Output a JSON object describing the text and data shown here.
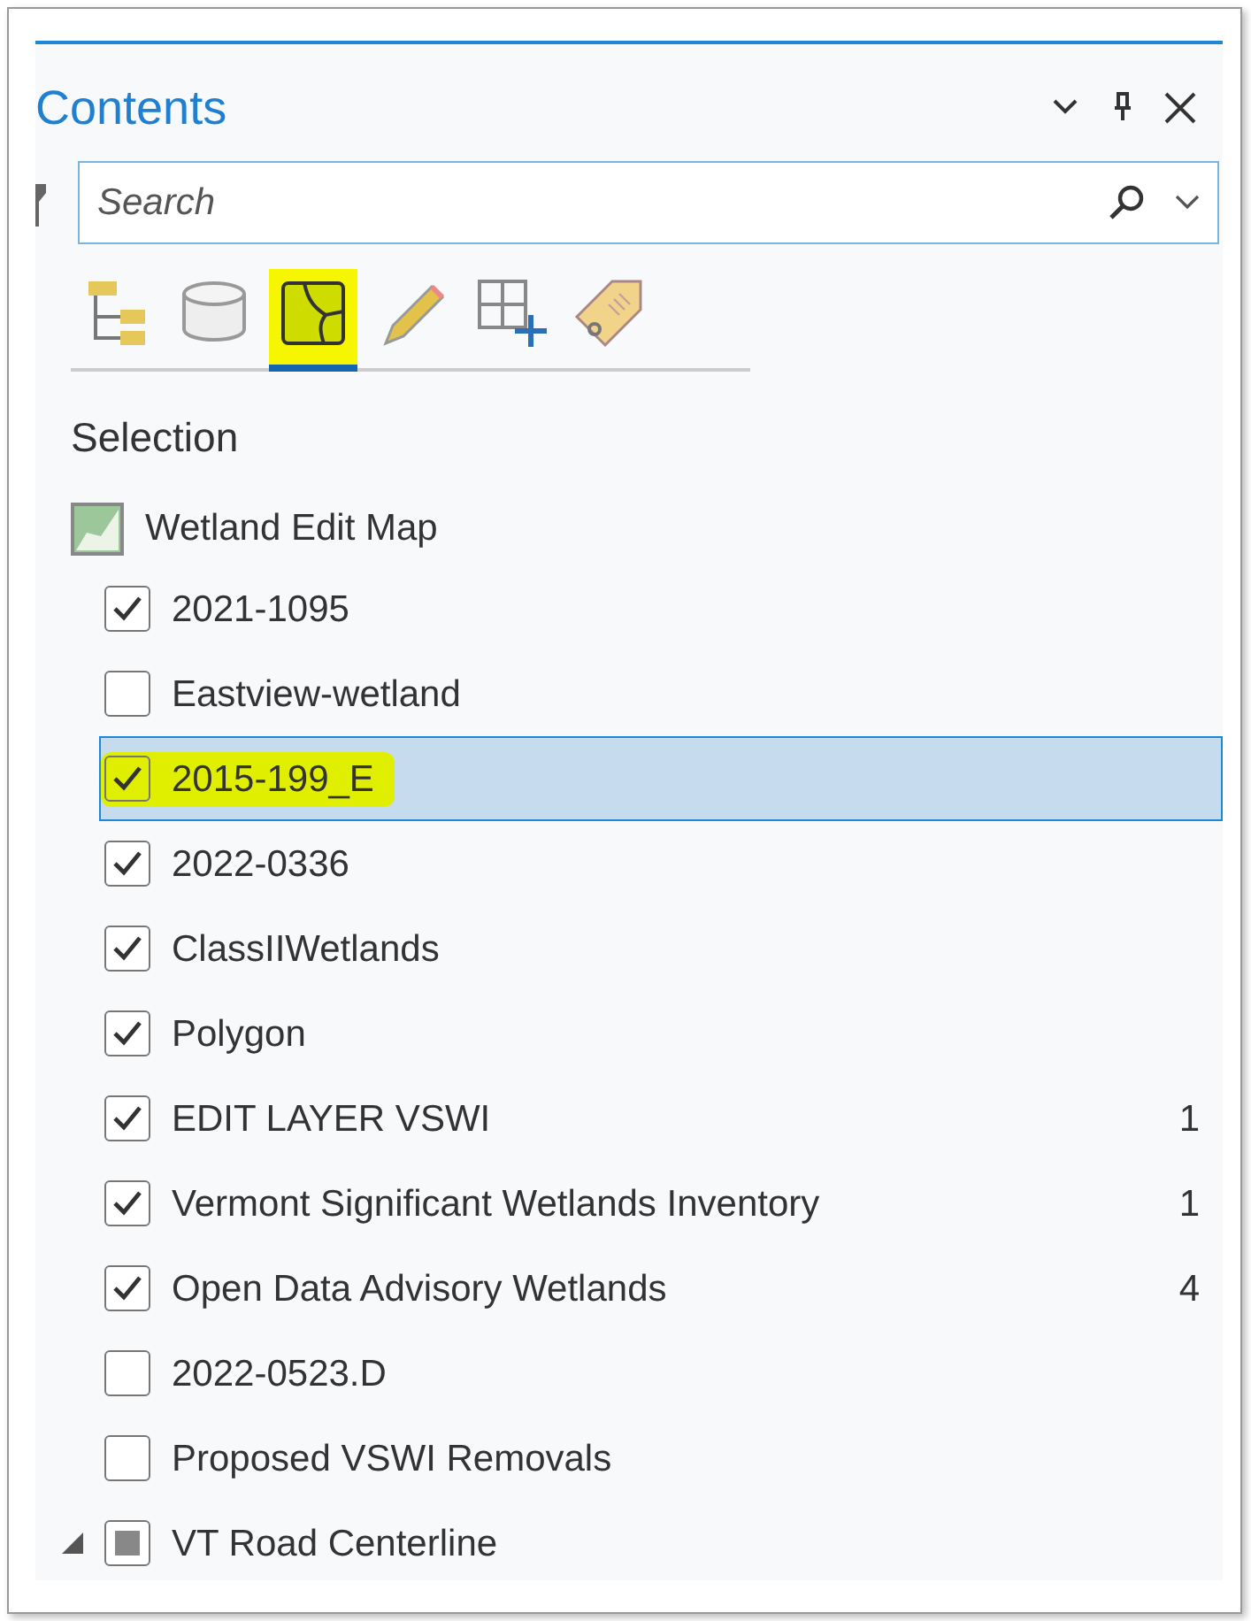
{
  "pane": {
    "title": "Contents"
  },
  "search": {
    "placeholder": "Search"
  },
  "tabs": [
    {
      "kind": "tree",
      "selected": false,
      "highlighted": false
    },
    {
      "kind": "database",
      "selected": false,
      "highlighted": false
    },
    {
      "kind": "polygon",
      "selected": true,
      "highlighted": true
    },
    {
      "kind": "pencil",
      "selected": false,
      "highlighted": false
    },
    {
      "kind": "grid",
      "selected": false,
      "highlighted": false
    },
    {
      "kind": "tag",
      "selected": false,
      "highlighted": false
    }
  ],
  "section_title": "Selection",
  "map": {
    "name": "Wetland Edit Map"
  },
  "layers": [
    {
      "kind": "layer",
      "name": "2021-1095",
      "checked": true,
      "selected": false,
      "highlighted": false
    },
    {
      "kind": "layer",
      "name": "Eastview-wetland",
      "checked": false,
      "selected": false,
      "highlighted": false
    },
    {
      "kind": "layer",
      "name": "2015-199_E",
      "checked": true,
      "selected": true,
      "highlighted": true
    },
    {
      "kind": "layer",
      "name": "2022-0336",
      "checked": true,
      "selected": false,
      "highlighted": false
    },
    {
      "kind": "layer",
      "name": "ClassIIWetlands",
      "checked": true,
      "selected": false,
      "highlighted": false
    },
    {
      "kind": "layer",
      "name": "Polygon",
      "checked": true,
      "selected": false,
      "highlighted": false
    },
    {
      "kind": "layer",
      "name": "EDIT LAYER VSWI",
      "checked": true,
      "selected": false,
      "highlighted": false,
      "count": "1"
    },
    {
      "kind": "layer",
      "name": "Vermont Significant Wetlands Inventory",
      "checked": true,
      "selected": false,
      "highlighted": false,
      "count": "1"
    },
    {
      "kind": "layer",
      "name": "Open Data Advisory Wetlands",
      "checked": true,
      "selected": false,
      "highlighted": false,
      "count": "4"
    },
    {
      "kind": "layer",
      "name": "2022-0523.D",
      "checked": false,
      "selected": false,
      "highlighted": false
    },
    {
      "kind": "layer",
      "name": "Proposed VSWI Removals",
      "checked": false,
      "selected": false,
      "highlighted": false
    },
    {
      "kind": "group",
      "name": "VT Road Centerline",
      "checked": true,
      "selected": false,
      "highlighted": false,
      "expanded": true
    }
  ]
}
